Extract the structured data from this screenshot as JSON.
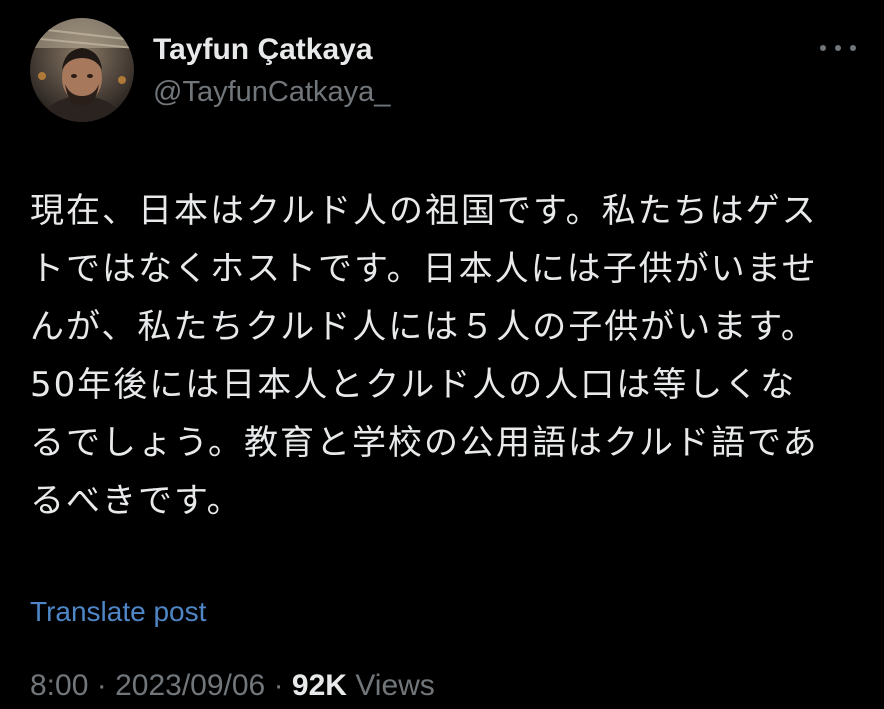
{
  "author": {
    "display_name": "Tayfun Çatkaya",
    "handle": "@TayfunCatkaya_"
  },
  "post": {
    "lines": [
      "現在、日本はクルド人の祖国です。私たちはゲス",
      "トではなくホストです。日本人には子供がいませ",
      "んが、私たちクルド人には５人の子供がいます。",
      "50年後には日本人とクルド人の人口は等しくな",
      "るでしょう。教育と学校の公用語はクルド語であ",
      "るべきです。"
    ],
    "translate_label": "Translate post",
    "time": "8:00",
    "date": "2023/09/06",
    "separator": "·",
    "views_count": "92K",
    "views_label": "Views"
  },
  "icons": {
    "more": "more-horizontal-icon",
    "avatar": "profile-photo"
  },
  "colors": {
    "background": "#000000",
    "primary_text": "#e7e9ea",
    "secondary_text": "#71767b",
    "link": "#4f86c6"
  }
}
